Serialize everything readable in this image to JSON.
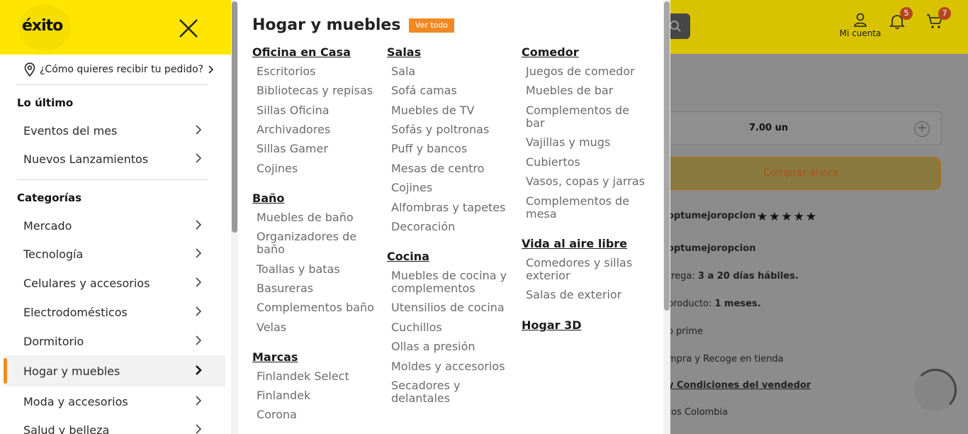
{
  "header": {
    "logo_text": "éxito",
    "account_label": "Mi cuenta",
    "notifications_count": "5",
    "cart_count": "7"
  },
  "drawer": {
    "delivery_prompt": "¿Cómo quieres recibir tu pedido?",
    "latest_title": "Lo último",
    "latest_items": [
      {
        "label": "Eventos del mes"
      },
      {
        "label": "Nuevos Lanzamientos"
      }
    ],
    "categories_title": "Categorías",
    "categories": [
      {
        "label": "Mercado"
      },
      {
        "label": "Tecnología"
      },
      {
        "label": "Celulares y accesorios"
      },
      {
        "label": "Electrodomésticos"
      },
      {
        "label": "Dormitorio"
      },
      {
        "label": "Hogar y muebles"
      },
      {
        "label": "Moda y accesorios"
      },
      {
        "label": "Salud y belleza"
      }
    ],
    "active_category": "Hogar y muebles"
  },
  "submenu": {
    "title": "Hogar y muebles",
    "see_all_label": "Ver todo",
    "col1": {
      "g1": {
        "title": "Oficina en Casa",
        "items": [
          "Escritorios",
          "Bibliotecas y repisas",
          "Sillas Oficina",
          "Archivadores",
          "Sillas Gamer",
          "Cojines"
        ]
      },
      "g2": {
        "title": "Baño",
        "items": [
          "Muebles de baño",
          "Organizadores de baño",
          "Toallas y batas",
          "Basureras",
          "Complementos baño",
          "Velas"
        ]
      },
      "g3": {
        "title": "Marcas",
        "items": [
          "Finlandek Select",
          "Finlandek",
          "Corona"
        ]
      }
    },
    "col2": {
      "g1": {
        "title": "Salas",
        "items": [
          "Sala",
          "Sofá camas",
          "Muebles de TV",
          "Sofás y poltronas",
          "Puff y bancos",
          "Mesas de centro",
          "Cojines",
          "Alfombras y tapetes",
          "Decoración"
        ]
      },
      "g2": {
        "title": "Cocina",
        "items": [
          "Muebles de cocina y complementos",
          "Utensilios de cocina",
          "Cuchillos",
          "Ollas a presión",
          "Moldes y accesorios",
          "Secadores y delantales"
        ]
      }
    },
    "col3": {
      "g1": {
        "title": "Comedor",
        "items": [
          "Juegos de comedor",
          "Muebles de bar",
          "Complementos de bar",
          "Vajillas y mugs",
          "Cubiertos",
          "Vasos, copas y jarras",
          "Complementos de mesa"
        ]
      },
      "g2": {
        "title": "Vida al aire libre",
        "items": [
          "Comedores y sillas exterior",
          "Salas de exterior"
        ]
      },
      "g3": {
        "title": "Hogar 3D"
      }
    }
  },
  "product": {
    "quantity": "7.00 un",
    "buy_label": "Comprar ahora",
    "seller_rating_name": "optumejoropcion",
    "rating_stars": 5,
    "seller_name": "optumejoropcion",
    "delivery_prefix": "trega: ",
    "delivery_value": "3 a 20 días hábiles.",
    "warranty_prefix": "producto: ",
    "warranty_value": "1 meses.",
    "prime_text": "o prime",
    "pickup_text": "mpra y Recoge en tienda",
    "terms_link": "y Condiciones del vendedor",
    "origin_text": "tos Colombia"
  },
  "colors": {
    "brand_yellow": "#ffe600",
    "accent_orange": "#f08a24"
  }
}
